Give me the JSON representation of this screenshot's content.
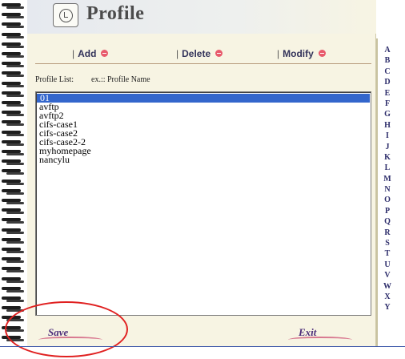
{
  "header": {
    "title": "Profile",
    "icon": "profile-icon"
  },
  "toolbar": {
    "add_label": "Add",
    "delete_label": "Delete",
    "modify_label": "Modify",
    "button_icon": "minus-circle-icon"
  },
  "profile_list": {
    "label": "Profile List:",
    "hint": "ex.:: Profile Name",
    "selected": "01",
    "items": [
      "01",
      "avftp",
      "avftp2",
      "cifs-case1",
      "cifs-case2",
      "cifs-case2-2",
      "myhomepage",
      "nancylu"
    ]
  },
  "footer": {
    "save_label": "Save",
    "exit_label": "Exit"
  },
  "alphabet": [
    "A",
    "B",
    "C",
    "D",
    "E",
    "F",
    "G",
    "H",
    "I",
    "J",
    "K",
    "L",
    "M",
    "N",
    "O",
    "P",
    "Q",
    "R",
    "S",
    "T",
    "U",
    "V",
    "W",
    "X",
    "Y"
  ],
  "colors": {
    "selection": "#3366cc",
    "button_dot": "#e85a6c",
    "annotation": "#e02020"
  }
}
